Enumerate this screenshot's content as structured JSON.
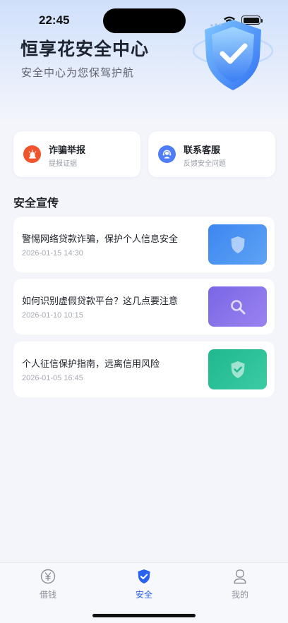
{
  "status_bar": {
    "time": "22:45"
  },
  "hero": {
    "title": "恒享花安全中心",
    "subtitle": "安全中心为您保驾护航",
    "illustration_icon": "shield-check-icon"
  },
  "quick_actions": [
    {
      "title": "诈骗举报",
      "subtitle": "提报证据",
      "icon": "alarm-icon",
      "color": "#f0542d"
    },
    {
      "title": "联系客服",
      "subtitle": "反馈安全问题",
      "icon": "headset-icon",
      "color": "#4f7cf7"
    }
  ],
  "section": {
    "title": "安全宣传"
  },
  "articles": [
    {
      "title": "警惕网络贷款诈骗，保护个人信息安全",
      "date": "2026-01-15 14:30",
      "icon": "shield-icon",
      "color_from": "#3d86f0",
      "color_to": "#5ea3f5"
    },
    {
      "title": "如何识别虚假贷款平台？这几点要注意",
      "date": "2026-01-10 10:15",
      "icon": "search-icon",
      "color_from": "#7a66e6",
      "color_to": "#9a83f0"
    },
    {
      "title": "个人征信保护指南，远离信用风险",
      "date": "2026-01-05 16:45",
      "icon": "shield-check-icon",
      "color_from": "#1fb88e",
      "color_to": "#3ccba3"
    }
  ],
  "tabbar": {
    "active_color": "#2a62f0",
    "items": [
      {
        "label": "借钱",
        "icon": "yuan-icon"
      },
      {
        "label": "安全",
        "icon": "shield-check-icon",
        "active": true
      },
      {
        "label": "我的",
        "icon": "user-icon"
      }
    ]
  }
}
